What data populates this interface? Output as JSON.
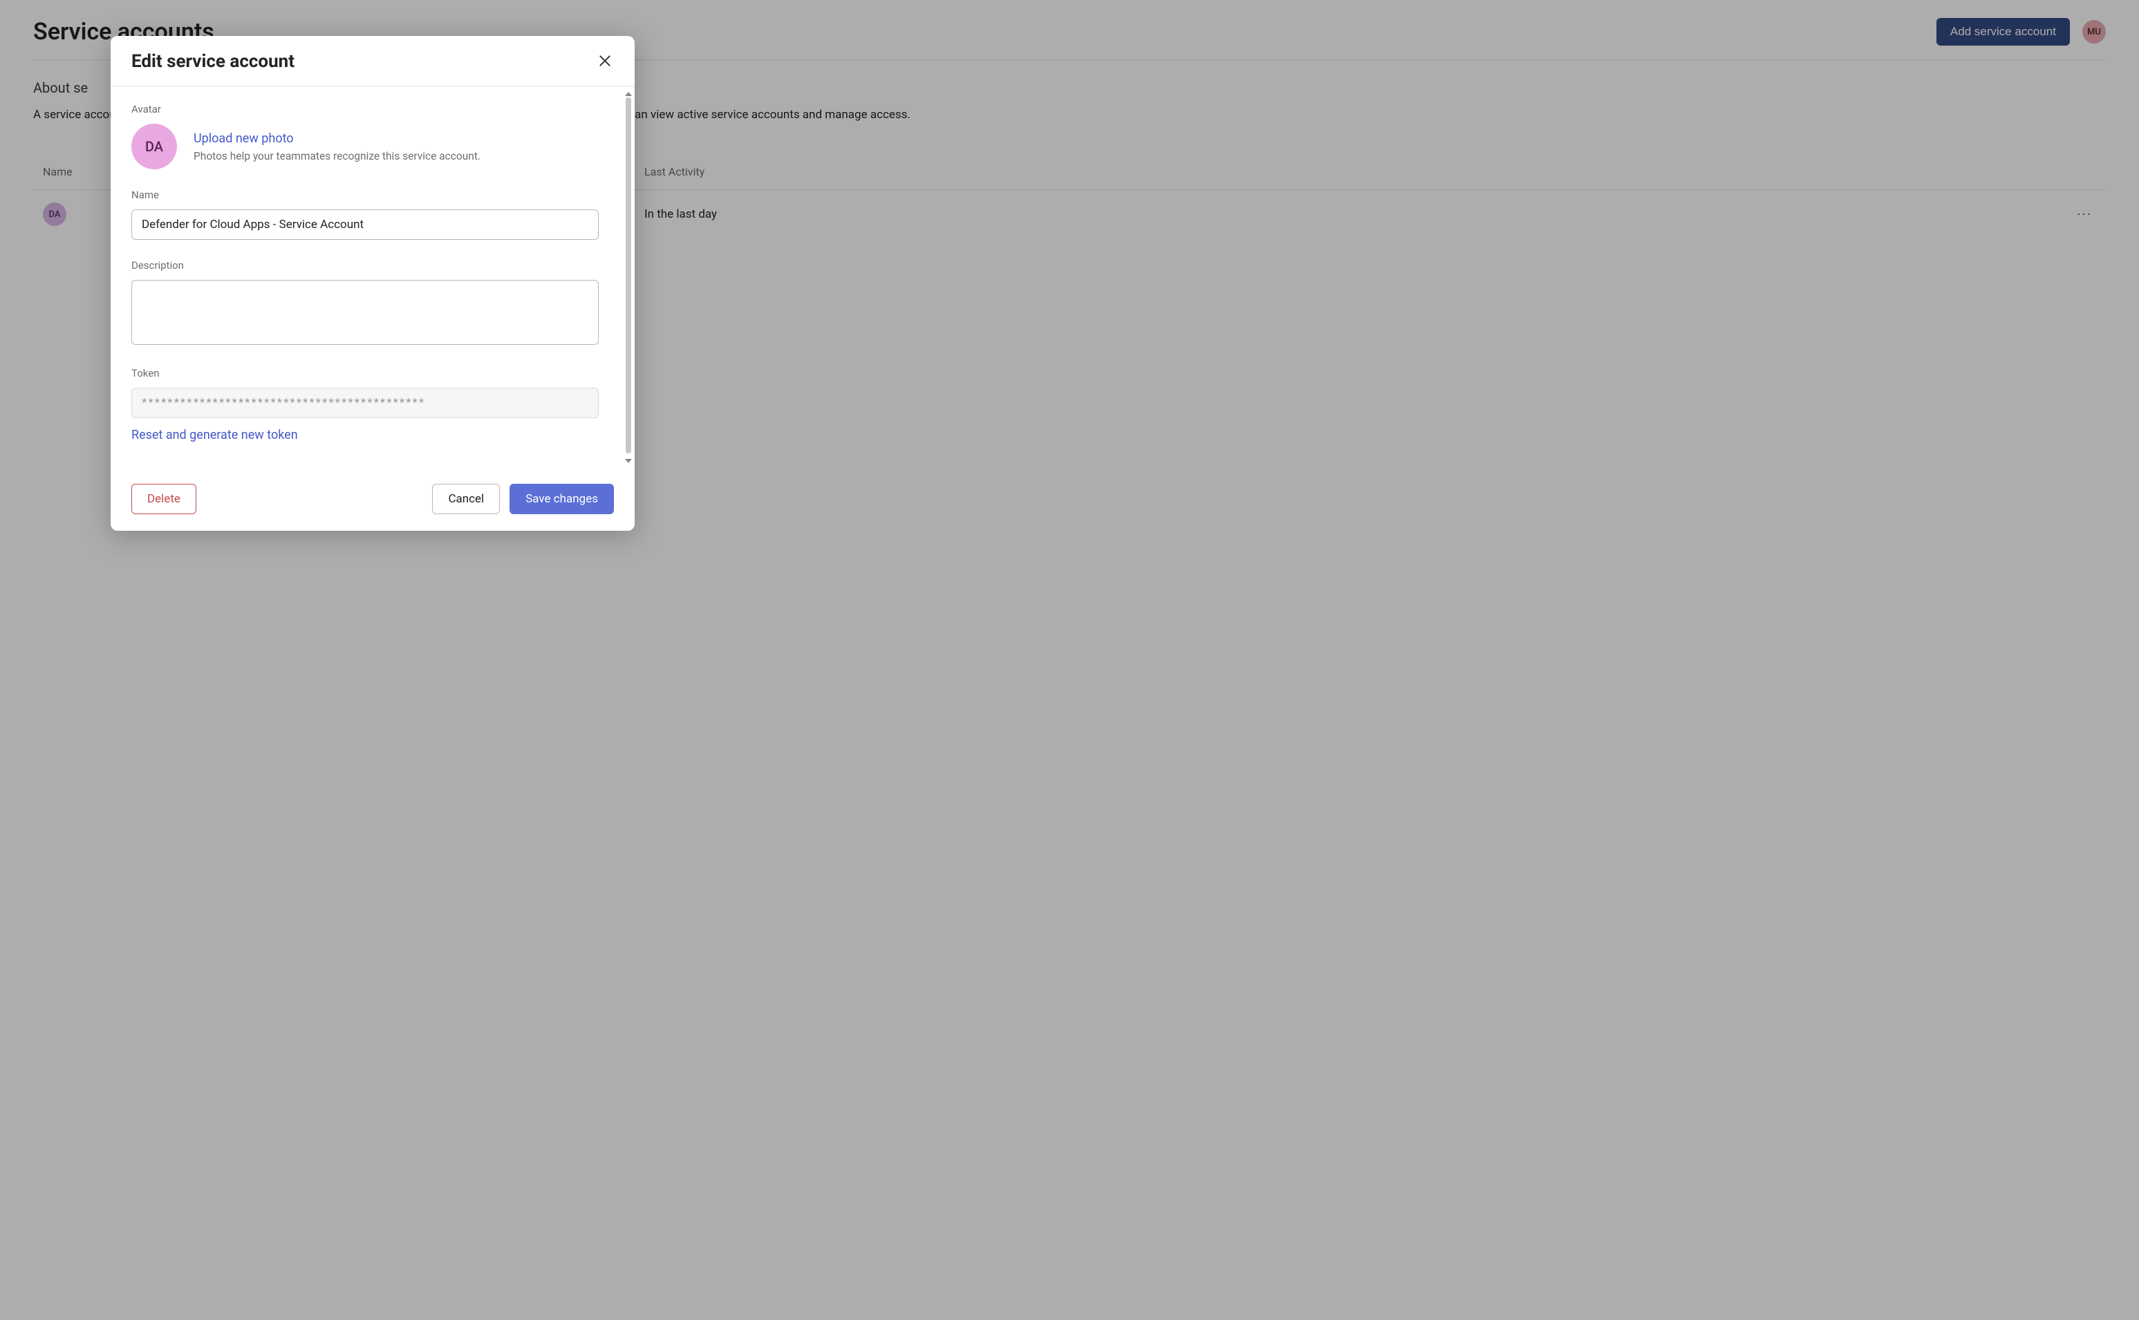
{
  "page": {
    "title": "Service accounts",
    "add_button": "Add service account",
    "user_avatar_initials": "MU",
    "about_heading_prefix": "About se",
    "about_text": "A service account is a non-human account that can be used to call APIs on behalf of your organization. All admins can view active service accounts and manage access.",
    "columns": {
      "name": "Name",
      "activity": "Last Activity"
    },
    "rows": [
      {
        "avatar_initials": "DA",
        "name": "",
        "activity": "In the last day"
      }
    ]
  },
  "modal": {
    "title": "Edit service account",
    "avatar_label": "Avatar",
    "avatar_initials": "DA",
    "upload_link": "Upload new photo",
    "avatar_hint": "Photos help your teammates recognize this service account.",
    "name_label": "Name",
    "name_value": "Defender for Cloud Apps - Service Account",
    "description_label": "Description",
    "description_value": "",
    "token_label": "Token",
    "token_value": "********************************************",
    "reset_token": "Reset and generate new token",
    "delete": "Delete",
    "cancel": "Cancel",
    "save": "Save changes"
  }
}
